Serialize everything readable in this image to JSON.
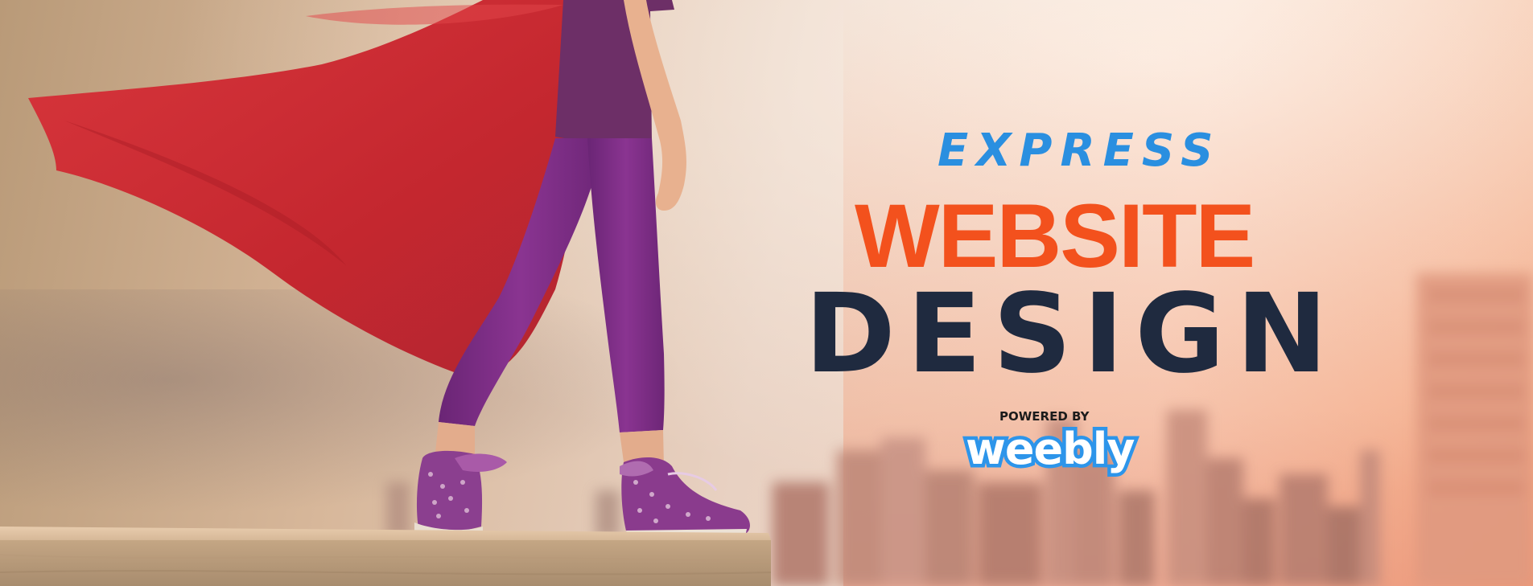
{
  "banner": {
    "brand_word": "EXPRESS",
    "title_line_1": "WEBSITE",
    "title_line_2": "DESIGN",
    "powered_by": "POWERED BY",
    "partner_logo_text": "weebly"
  },
  "colors": {
    "express_blue": "#2a8fe0",
    "website_orange": "#f3511d",
    "design_navy": "#1f2a3f",
    "weebly_blue": "#2d95ea",
    "cape_red": "#c9252c",
    "leggings_purple": "#7b2a83"
  }
}
